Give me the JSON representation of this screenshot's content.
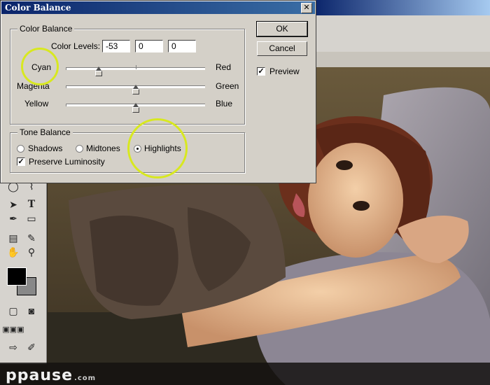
{
  "dialog": {
    "title": "Color Balance",
    "close_glyph": "✕"
  },
  "color_balance": {
    "group_label": "Color Balance",
    "levels_label": "Color Levels:",
    "levels": [
      "-53",
      "0",
      "0"
    ],
    "sliders": [
      {
        "left": "Cyan",
        "right": "Red",
        "value": -53
      },
      {
        "left": "Magenta",
        "right": "Green",
        "value": 0
      },
      {
        "left": "Yellow",
        "right": "Blue",
        "value": 0
      }
    ]
  },
  "tone_balance": {
    "group_label": "Tone Balance",
    "options": [
      "Shadows",
      "Midtones",
      "Highlights"
    ],
    "selected": "Highlights",
    "preserve_label": "Preserve Luminosity",
    "preserve_checked": true
  },
  "buttons": {
    "ok": "OK",
    "cancel": "Cancel",
    "preview_label": "Preview",
    "preview_checked": true
  },
  "watermark": {
    "brand": "ppause",
    "suffix": ".com"
  },
  "colors": {
    "titlebar": "#0a246a",
    "dialog_bg": "#d4d0c8",
    "annotation_ring": "#d8e820"
  },
  "toolbox_icons": [
    "ellipse-icon",
    "lasso-icon",
    "move-arrow-icon",
    "text-tool-icon",
    "pen-icon",
    "rectangle-icon",
    "notes-icon",
    "eyedropper-icon",
    "hand-icon",
    "zoom-icon",
    "color-swatch-icon",
    "quickmask-icon",
    "screenmode-icon",
    "jump-to-icon"
  ]
}
